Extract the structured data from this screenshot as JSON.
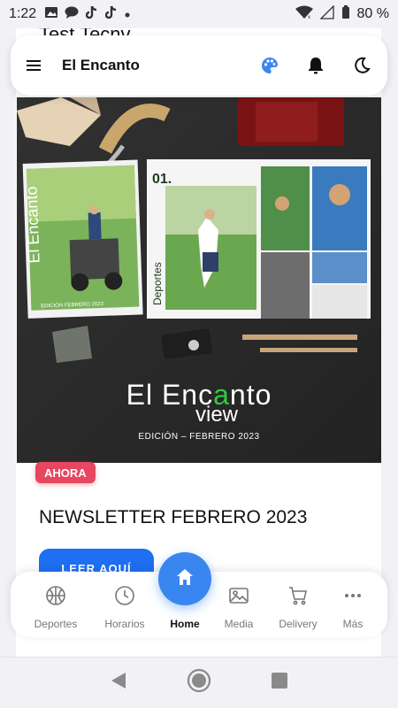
{
  "status_bar": {
    "time": "1:22",
    "battery": "80 %",
    "notification_icons": [
      "image-icon",
      "chat-icon",
      "tiktok-icon",
      "tiktok-icon",
      "dot-icon"
    ]
  },
  "behind_title": "Test Tecnv",
  "header": {
    "title": "El Encanto",
    "icons": [
      "menu-icon",
      "palette-icon",
      "bell-icon",
      "moon-icon"
    ]
  },
  "hero": {
    "title_a": "El Enc",
    "title_accent": "a",
    "title_b": "nto",
    "subtitle": "view",
    "edition": "EDICIÓN – FEBRERO 2023",
    "magazine_page_number": "01.",
    "magazine_section": "Deportes",
    "magazine_cover_text": "El Encanto",
    "magazine_cover_edition": "EDICIÓN FEBRERO 2023"
  },
  "badge": "AHORA",
  "newsletter_title": "NEWSLETTER FEBRERO 2023",
  "read_button": "LEER AQUÍ",
  "nav": [
    {
      "label": "Deportes",
      "icon": "basketball-icon"
    },
    {
      "label": "Horarios",
      "icon": "clock-icon"
    },
    {
      "label": "Home",
      "icon": "home-icon",
      "active": true
    },
    {
      "label": "Media",
      "icon": "image-icon"
    },
    {
      "label": "Delivery",
      "icon": "cart-icon"
    },
    {
      "label": "Más",
      "icon": "more-icon"
    }
  ],
  "colors": {
    "accent_blue": "#3a86f0",
    "button_blue": "#1e6ff2",
    "badge_red": "#e64660",
    "hero_green": "#2ecc40"
  }
}
